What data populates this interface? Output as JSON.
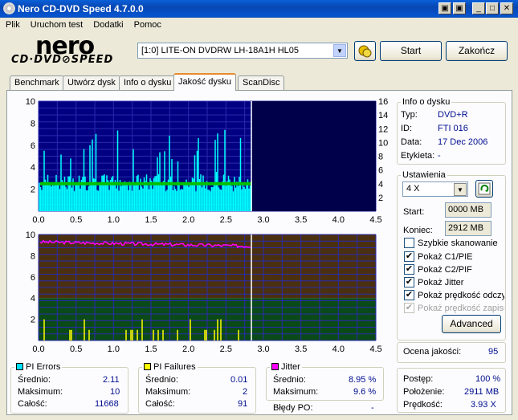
{
  "window": {
    "title": "Nero CD-DVD Speed 4.7.0.0"
  },
  "title_buttons": {
    "b1": "▣",
    "b2": "▣",
    "min": "_",
    "max": "□",
    "close": "✕"
  },
  "menu": [
    "Plik",
    "Uruchom test",
    "Dodatki",
    "Pomoc"
  ],
  "logo": {
    "nero": "nero",
    "cdspeed": "CD·DVD⊘SPEED"
  },
  "drive": {
    "selected": "[1:0]    LITE-ON DVDRW LH-18A1H HL05"
  },
  "buttons": {
    "start": "Start",
    "end": "Zakończ",
    "advanced": "Advanced"
  },
  "tabs": [
    "Benchmark",
    "Utwórz dysk",
    "Info o dysku",
    "Jakość dysku",
    "ScanDisc"
  ],
  "active_tab": "Jakość dysku",
  "disc_info": {
    "title": "Info o dysku",
    "rows": [
      {
        "label": "Typ:",
        "value": "DVD+R"
      },
      {
        "label": "ID:",
        "value": "FTI 016"
      },
      {
        "label": "Data:",
        "value": "17 Dec 2006"
      },
      {
        "label": "Etykieta:",
        "value": "-"
      }
    ]
  },
  "settings": {
    "title": "Ustawienia",
    "speed": "4 X",
    "start_label": "Start:",
    "start_value": "0000 MB",
    "end_label": "Koniec:",
    "end_value": "2912 MB",
    "checks": [
      {
        "label": "Szybkie skanowanie",
        "checked": false,
        "disabled": false
      },
      {
        "label": "Pokaż C1/PIE",
        "checked": true,
        "disabled": false
      },
      {
        "label": "Pokaż C2/PIF",
        "checked": true,
        "disabled": false
      },
      {
        "label": "Pokaż Jitter",
        "checked": true,
        "disabled": false
      },
      {
        "label": "Pokaż prędkość odczytu",
        "checked": true,
        "disabled": false
      },
      {
        "label": "Pokaż prędkość zapisu",
        "checked": true,
        "disabled": true
      }
    ]
  },
  "quality": {
    "label": "Ocena jakości:",
    "value": "95"
  },
  "progress": {
    "rows": [
      {
        "label": "Postęp:",
        "value": "100 %"
      },
      {
        "label": "Położenie:",
        "value": "2911 MB"
      },
      {
        "label": "Prędkość:",
        "value": "3.93 X"
      }
    ]
  },
  "pi_errors": {
    "title": "PI Errors",
    "color": "#00e0ff",
    "rows": [
      {
        "label": "Średnio:",
        "value": "2.11"
      },
      {
        "label": "Maksimum:",
        "value": "10"
      },
      {
        "label": "Całość:",
        "value": "11668"
      }
    ]
  },
  "pi_failures": {
    "title": "PI Failures",
    "color": "#ffff00",
    "rows": [
      {
        "label": "Średnio:",
        "value": "0.01"
      },
      {
        "label": "Maksimum:",
        "value": "2"
      },
      {
        "label": "Całość:",
        "value": "91"
      }
    ]
  },
  "jitter": {
    "title": "Jitter",
    "color": "#ff00ff",
    "rows": [
      {
        "label": "Średnio:",
        "value": "8.95 %"
      },
      {
        "label": "Maksimum:",
        "value": "9.6 %"
      }
    ],
    "po_label": "Błędy PO:",
    "po_value": "-"
  },
  "chart_data": [
    {
      "type": "area",
      "x_ticks": [
        "0.0",
        "0.5",
        "1.0",
        "1.5",
        "2.0",
        "2.5",
        "3.0",
        "3.5",
        "4.0",
        "4.5"
      ],
      "y_left_ticks": [
        "2",
        "4",
        "6",
        "8",
        "10"
      ],
      "y_right_ticks": [
        "2",
        "4",
        "6",
        "8",
        "10",
        "12",
        "14",
        "16"
      ],
      "xlim": [
        0,
        4.5
      ],
      "ylim": [
        0,
        10
      ],
      "y2lim": [
        0,
        16
      ],
      "position_marker": 2.84,
      "colors": {
        "pie": "#00ffff",
        "speed": "#00c000",
        "background": "#000080"
      },
      "series": [
        {
          "values_x_end": 2.84,
          "avg_pie": 2.11,
          "max_pie": 10
        },
        {
          "speed_level": 4
        }
      ]
    },
    {
      "type": "area",
      "x_ticks": [
        "0.0",
        "0.5",
        "1.0",
        "1.5",
        "2.0",
        "2.5",
        "3.0",
        "3.5",
        "4.0",
        "4.5"
      ],
      "y_left_ticks": [
        "2",
        "4",
        "6",
        "8",
        "10"
      ],
      "xlim": [
        0,
        4.5
      ],
      "ylim": [
        0,
        10
      ],
      "position_marker": 2.84,
      "colors": {
        "pif": "#ffff00",
        "jitter": "#ff00ff"
      },
      "series": [
        {
          "values_x_end": 2.84,
          "max_pif": 2
        },
        {
          "jitter_start": 9.3,
          "jitter_end": 8.9
        }
      ]
    }
  ]
}
